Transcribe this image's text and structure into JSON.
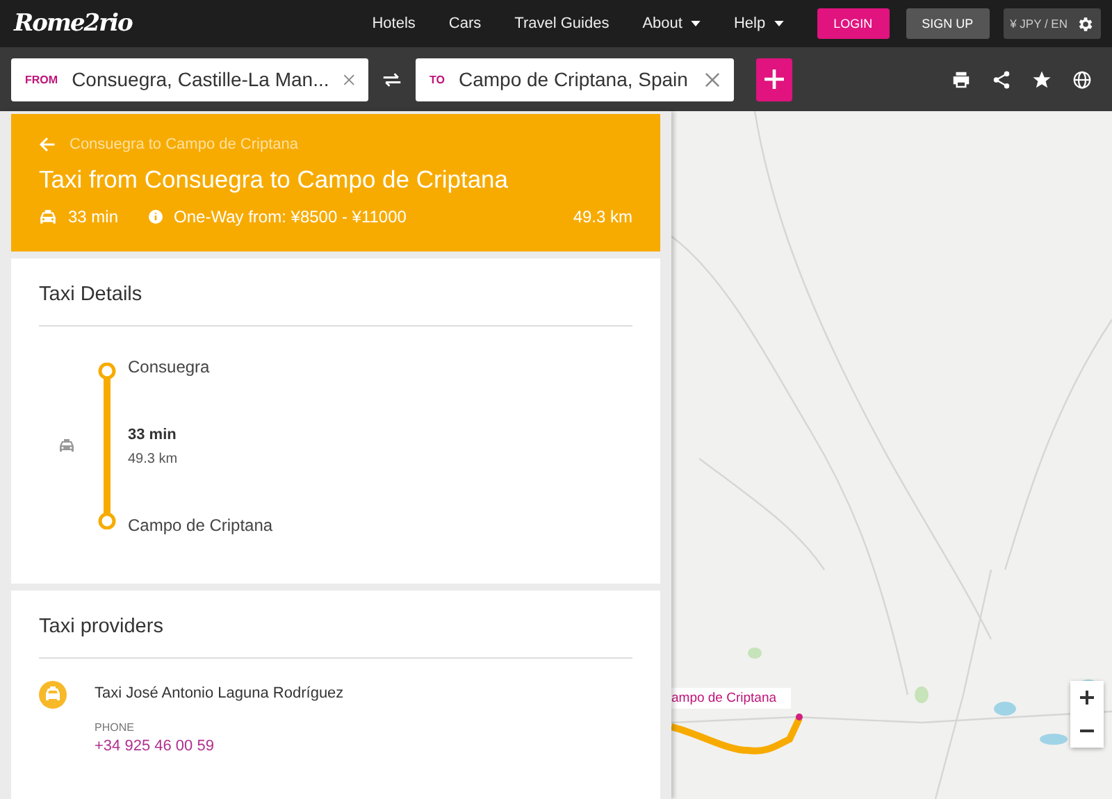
{
  "header": {
    "logo": "Rome2rio",
    "nav": [
      {
        "label": "Hotels",
        "dropdown": false
      },
      {
        "label": "Cars",
        "dropdown": false
      },
      {
        "label": "Travel Guides",
        "dropdown": false
      },
      {
        "label": "About",
        "dropdown": true
      },
      {
        "label": "Help",
        "dropdown": true
      }
    ],
    "login": "LOGIN",
    "signup": "SIGN UP",
    "currency": "¥ JPY / EN"
  },
  "search": {
    "from": {
      "label": "FROM",
      "value": "Consuegra, Castille-La Man..."
    },
    "to": {
      "label": "TO",
      "value": "Campo de Criptana, Spain"
    }
  },
  "route_header": {
    "breadcrumb": "Consuegra to Campo de Criptana",
    "title": "Taxi from Consuegra to Campo de Criptana",
    "duration": "33 min",
    "fare": "One-Way from: ¥8500 - ¥11000",
    "distance": "49.3 km"
  },
  "taxi_details": {
    "title": "Taxi Details",
    "origin": "Consuegra",
    "duration": "33 min",
    "distance": "49.3 km",
    "destination": "Campo de Criptana"
  },
  "taxi_providers": {
    "title": "Taxi providers",
    "providers": [
      {
        "name": "Taxi José Antonio Laguna Rodríguez",
        "phone_label": "PHONE",
        "phone": "+34 925 46 00 59"
      }
    ]
  },
  "map": {
    "marker_label": "ampo de Criptana"
  }
}
